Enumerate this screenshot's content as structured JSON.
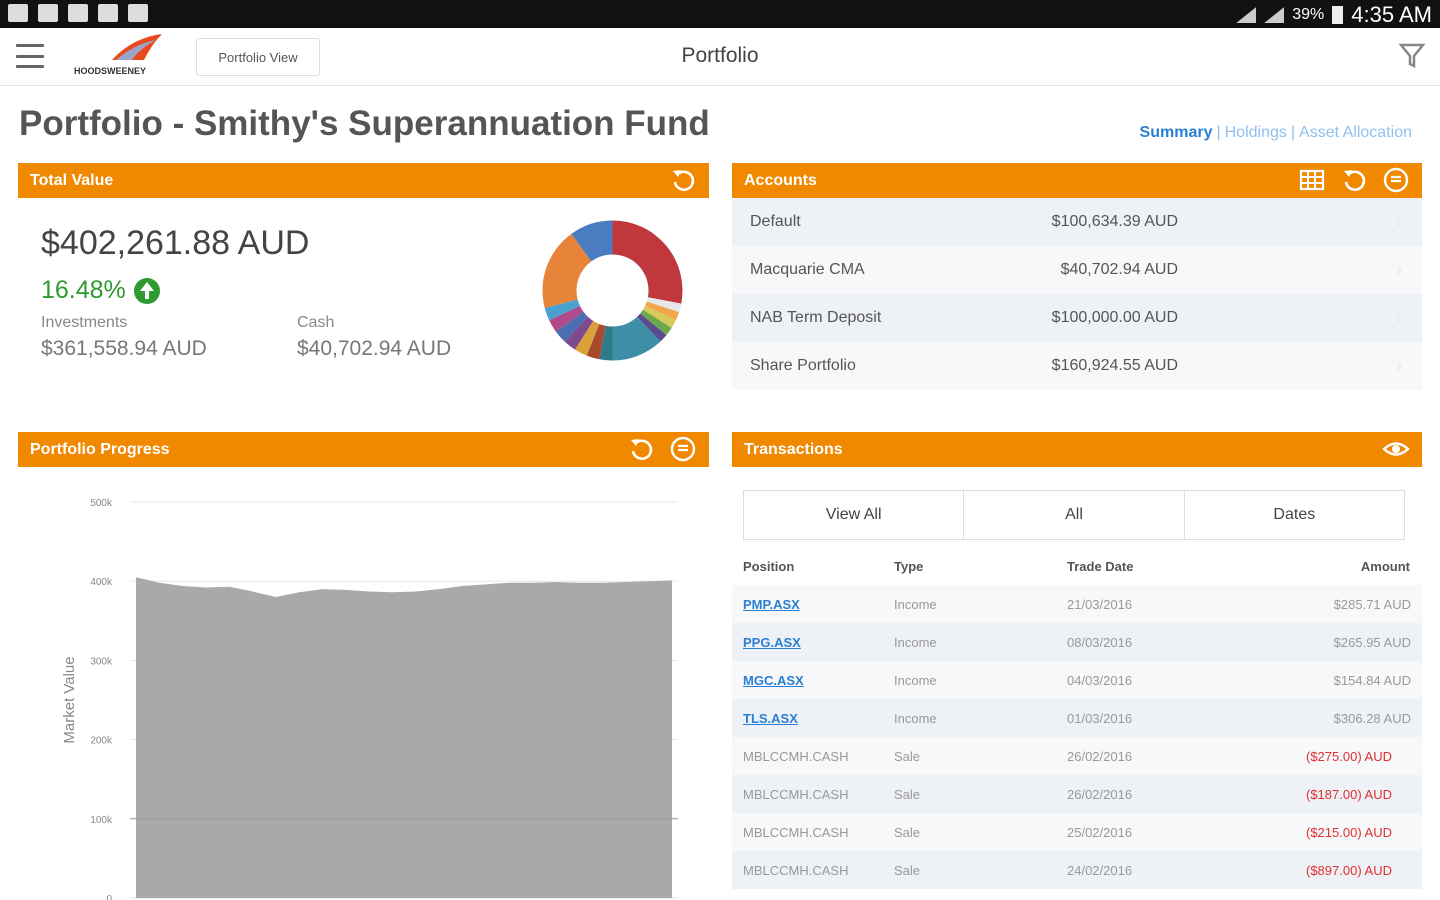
{
  "status_bar": {
    "battery": "39%",
    "time": "4:35 AM"
  },
  "appbar": {
    "logo_text": "HOODSWEENEY",
    "portfolio_view_button": "Portfolio View",
    "title": "Portfolio"
  },
  "page": {
    "title": "Portfolio - Smithy's Superannuation Fund",
    "tabs": [
      "Summary",
      "Holdings",
      "Asset Allocation"
    ],
    "tab_separator": "|"
  },
  "total_value": {
    "header": "Total Value",
    "amount": "$402,261.88 AUD",
    "change_pct": "16.48%",
    "investments_label": "Investments",
    "investments_value": "$361,558.94 AUD",
    "cash_label": "Cash",
    "cash_value": "$40,702.94 AUD",
    "donut_slices": [
      {
        "value": 28,
        "color": "#c0383b"
      },
      {
        "value": 2,
        "color": "#e6e6e6"
      },
      {
        "value": 2,
        "color": "#f2a64a"
      },
      {
        "value": 2,
        "color": "#d8c95b"
      },
      {
        "value": 2,
        "color": "#6aa94e"
      },
      {
        "value": 2,
        "color": "#5a4b8f"
      },
      {
        "value": 12,
        "color": "#3f8ea7"
      },
      {
        "value": 3,
        "color": "#2f7b8c"
      },
      {
        "value": 3,
        "color": "#a84a2c"
      },
      {
        "value": 3,
        "color": "#d8a13a"
      },
      {
        "value": 3,
        "color": "#7d4a8c"
      },
      {
        "value": 3,
        "color": "#4b6fb0"
      },
      {
        "value": 3,
        "color": "#b04a8c"
      },
      {
        "value": 3,
        "color": "#4aa0d0"
      },
      {
        "value": 19,
        "color": "#e8843a"
      },
      {
        "value": 10,
        "color": "#4a7cc0"
      }
    ]
  },
  "accounts": {
    "header": "Accounts",
    "rows": [
      {
        "name": "Default",
        "value": "$100,634.39 AUD"
      },
      {
        "name": "Macquarie CMA",
        "value": "$40,702.94 AUD"
      },
      {
        "name": "NAB Term Deposit",
        "value": "$100,000.00 AUD"
      },
      {
        "name": "Share Portfolio",
        "value": "$160,924.55 AUD"
      }
    ]
  },
  "progress": {
    "header": "Portfolio Progress",
    "ylabel": "Market Value"
  },
  "transactions": {
    "header": "Transactions",
    "filters": [
      "View All",
      "All",
      "Dates"
    ],
    "columns": [
      "Position",
      "Type",
      "Trade Date",
      "Amount"
    ],
    "rows": [
      {
        "position": "PMP.ASX",
        "type": "Income",
        "date": "21/03/2016",
        "amount": "$285.71 AUD"
      },
      {
        "position": "PPG.ASX",
        "type": "Income",
        "date": "08/03/2016",
        "amount": "$265.95 AUD"
      },
      {
        "position": "MGC.ASX",
        "type": "Income",
        "date": "04/03/2016",
        "amount": "$154.84 AUD"
      },
      {
        "position": "TLS.ASX",
        "type": "Income",
        "date": "01/03/2016",
        "amount": "$306.28 AUD"
      },
      {
        "position": "MBLCCMH.CASH",
        "type": "Sale",
        "date": "26/02/2016",
        "amount": "($275.00) AUD"
      },
      {
        "position": "MBLCCMH.CASH",
        "type": "Sale",
        "date": "26/02/2016",
        "amount": "($187.00) AUD"
      },
      {
        "position": "MBLCCMH.CASH",
        "type": "Sale",
        "date": "25/02/2016",
        "amount": "($215.00) AUD"
      },
      {
        "position": "MBLCCMH.CASH",
        "type": "Sale",
        "date": "24/02/2016",
        "amount": "($897.00) AUD"
      }
    ]
  },
  "chart_data": {
    "type": "area",
    "title": "",
    "xlabel": "",
    "ylabel": "Market Value",
    "ylim": [
      0,
      500000
    ],
    "yticks": [
      "0",
      "100k",
      "200k",
      "300k",
      "400k",
      "500k"
    ],
    "ytick_values": [
      0,
      100000,
      200000,
      300000,
      400000,
      500000
    ],
    "grid": true,
    "series": [
      {
        "values": [
          405000,
          398000,
          394000,
          392000,
          393000,
          387000,
          380000,
          386000,
          390000,
          389000,
          387000,
          386000,
          387000,
          390000,
          394000,
          396000,
          398000,
          398000,
          399000,
          398000,
          398000,
          399000,
          400000,
          401000
        ]
      }
    ],
    "color": "#a9a9a9"
  }
}
